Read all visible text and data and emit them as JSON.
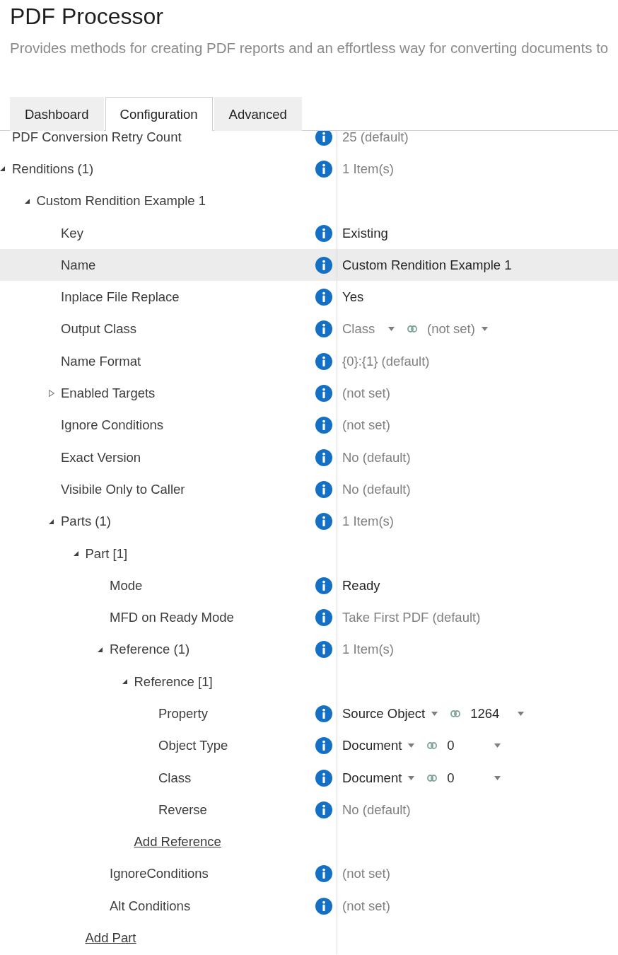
{
  "header": {
    "title": "PDF Processor",
    "description": "Provides methods for creating PDF reports and an effortless way for converting documents to"
  },
  "tabs": [
    {
      "label": "Dashboard",
      "selected": false
    },
    {
      "label": "Configuration",
      "selected": true
    },
    {
      "label": "Advanced",
      "selected": false
    }
  ],
  "tree": [
    {
      "kind": "property",
      "label": "PDF Conversion Retry Count",
      "selected": false,
      "value": {
        "kind": "text",
        "text": "25 (default)",
        "set": false
      }
    },
    {
      "kind": "group",
      "label": "Renditions (1)",
      "expanded": true,
      "selected": false,
      "value": {
        "kind": "text",
        "text": "1 Item(s)",
        "set": false
      },
      "children": [
        {
          "kind": "group",
          "label": "Custom Rendition Example 1",
          "expanded": true,
          "selected": false,
          "children": [
            {
              "kind": "property",
              "label": "Key",
              "selected": false,
              "value": {
                "kind": "text",
                "text": "Existing",
                "set": true
              }
            },
            {
              "kind": "property",
              "label": "Name",
              "selected": true,
              "value": {
                "kind": "text",
                "text": "Custom Rendition Example 1",
                "set": true
              }
            },
            {
              "kind": "property",
              "label": "Inplace File Replace",
              "selected": false,
              "value": {
                "kind": "text",
                "text": "Yes",
                "set": true
              }
            },
            {
              "kind": "property",
              "label": "Output Class",
              "selected": false,
              "value": {
                "kind": "picker",
                "dropdowns": [
                  {
                    "text": "Class",
                    "set": false
                  },
                  {
                    "text": "(not set)",
                    "set": false
                  }
                ]
              }
            },
            {
              "kind": "property",
              "label": "Name Format",
              "selected": false,
              "value": {
                "kind": "text",
                "text": "{0}:{1} (default)",
                "set": false
              }
            },
            {
              "kind": "group",
              "label": "Enabled Targets",
              "expanded": false,
              "selected": false,
              "value": {
                "kind": "text",
                "text": "(not set)",
                "set": false
              }
            },
            {
              "kind": "property",
              "label": "Ignore Conditions",
              "selected": false,
              "value": {
                "kind": "text",
                "text": "(not set)",
                "set": false
              }
            },
            {
              "kind": "property",
              "label": "Exact Version",
              "selected": false,
              "value": {
                "kind": "text",
                "text": "No (default)",
                "set": false
              }
            },
            {
              "kind": "property",
              "label": "Visibile Only to Caller",
              "selected": false,
              "value": {
                "kind": "text",
                "text": "No (default)",
                "set": false
              }
            },
            {
              "kind": "group",
              "label": "Parts (1)",
              "expanded": true,
              "selected": false,
              "value": {
                "kind": "text",
                "text": "1 Item(s)",
                "set": false
              },
              "children": [
                {
                  "kind": "group",
                  "label": "Part [1]",
                  "expanded": true,
                  "selected": false,
                  "children": [
                    {
                      "kind": "property",
                      "label": "Mode",
                      "selected": false,
                      "value": {
                        "kind": "text",
                        "text": "Ready",
                        "set": true
                      }
                    },
                    {
                      "kind": "property",
                      "label": "MFD on Ready Mode",
                      "selected": false,
                      "value": {
                        "kind": "text",
                        "text": "Take First PDF (default)",
                        "set": false
                      }
                    },
                    {
                      "kind": "group",
                      "label": "Reference (1)",
                      "expanded": true,
                      "selected": false,
                      "value": {
                        "kind": "text",
                        "text": "1 Item(s)",
                        "set": false
                      },
                      "children": [
                        {
                          "kind": "group",
                          "label": "Reference [1]",
                          "expanded": true,
                          "selected": false,
                          "children": [
                            {
                              "kind": "property",
                              "label": "Property",
                              "selected": false,
                              "value": {
                                "kind": "picker",
                                "dropdowns": [
                                  {
                                    "text": "Source Object",
                                    "set": true
                                  },
                                  {
                                    "text": "1264",
                                    "set": true
                                  }
                                ]
                              }
                            },
                            {
                              "kind": "property",
                              "label": "Object Type",
                              "selected": false,
                              "value": {
                                "kind": "picker",
                                "dropdowns": [
                                  {
                                    "text": "Document",
                                    "set": true
                                  },
                                  {
                                    "text": "0",
                                    "set": true
                                  }
                                ]
                              }
                            },
                            {
                              "kind": "property",
                              "label": "Class",
                              "selected": false,
                              "value": {
                                "kind": "picker",
                                "dropdowns": [
                                  {
                                    "text": "Document",
                                    "set": true
                                  },
                                  {
                                    "text": "0",
                                    "set": true
                                  }
                                ]
                              }
                            },
                            {
                              "kind": "property",
                              "label": "Reverse",
                              "selected": false,
                              "value": {
                                "kind": "text",
                                "text": "No (default)",
                                "set": false
                              }
                            }
                          ]
                        },
                        {
                          "kind": "link",
                          "label": "Add Reference",
                          "selected": false
                        }
                      ]
                    },
                    {
                      "kind": "property",
                      "label": "IgnoreConditions",
                      "selected": false,
                      "value": {
                        "kind": "text",
                        "text": "(not set)",
                        "set": false
                      }
                    },
                    {
                      "kind": "property",
                      "label": "Alt Conditions",
                      "selected": false,
                      "value": {
                        "kind": "text",
                        "text": "(not set)",
                        "set": false
                      }
                    }
                  ]
                },
                {
                  "kind": "link",
                  "label": "Add Part",
                  "selected": false
                }
              ]
            }
          ]
        }
      ]
    }
  ]
}
